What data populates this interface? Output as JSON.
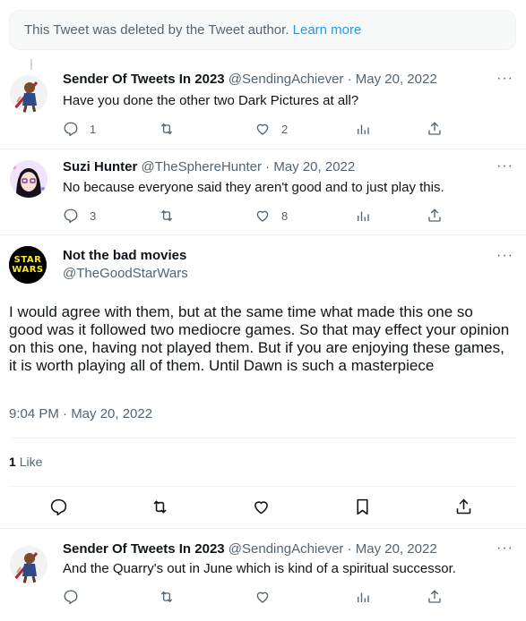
{
  "deleted_notice": {
    "text": "This Tweet was deleted by the Tweet author.",
    "link": "Learn more"
  },
  "replies": [
    {
      "name": "Sender Of Tweets In 2023",
      "handle": "@SendingAchiever",
      "date": "May 20, 2022",
      "text": "Have you done the other two Dark Pictures at all?",
      "reply_count": "1",
      "retweet_count": "",
      "like_count": "2",
      "views_count": ""
    },
    {
      "name": "Suzi Hunter",
      "handle": "@TheSphereHunter",
      "date": "May 20, 2022",
      "text": "No because everyone said they aren't good and to just play this.",
      "reply_count": "3",
      "retweet_count": "",
      "like_count": "8",
      "views_count": ""
    }
  ],
  "main_tweet": {
    "name": "Not the bad movies",
    "handle": "@TheGoodStarWars",
    "avatar_text": "STAR WARS",
    "text": "I would agree with them, but at the same time what made this one so good was it followed two mediocre games. So that may effect your opinion on this one, having not played them. But if you are enjoying these games, it is worth playing all of them. Until Dawn is such a masterpiece",
    "timestamp": "9:04 PM · May 20, 2022",
    "likes_count": "1",
    "likes_label": "Like"
  },
  "last_reply": {
    "name": "Sender Of Tweets In 2023",
    "handle": "@SendingAchiever",
    "date": "May 20, 2022",
    "text": "And the Quarry's out in June which is kind of a spiritual successor."
  },
  "separator": "·",
  "more_glyph": "···",
  "colors": {
    "link": "#1d9bf0",
    "secondary": "#536471",
    "primary": "#0f1419",
    "border": "#eff3f4"
  }
}
